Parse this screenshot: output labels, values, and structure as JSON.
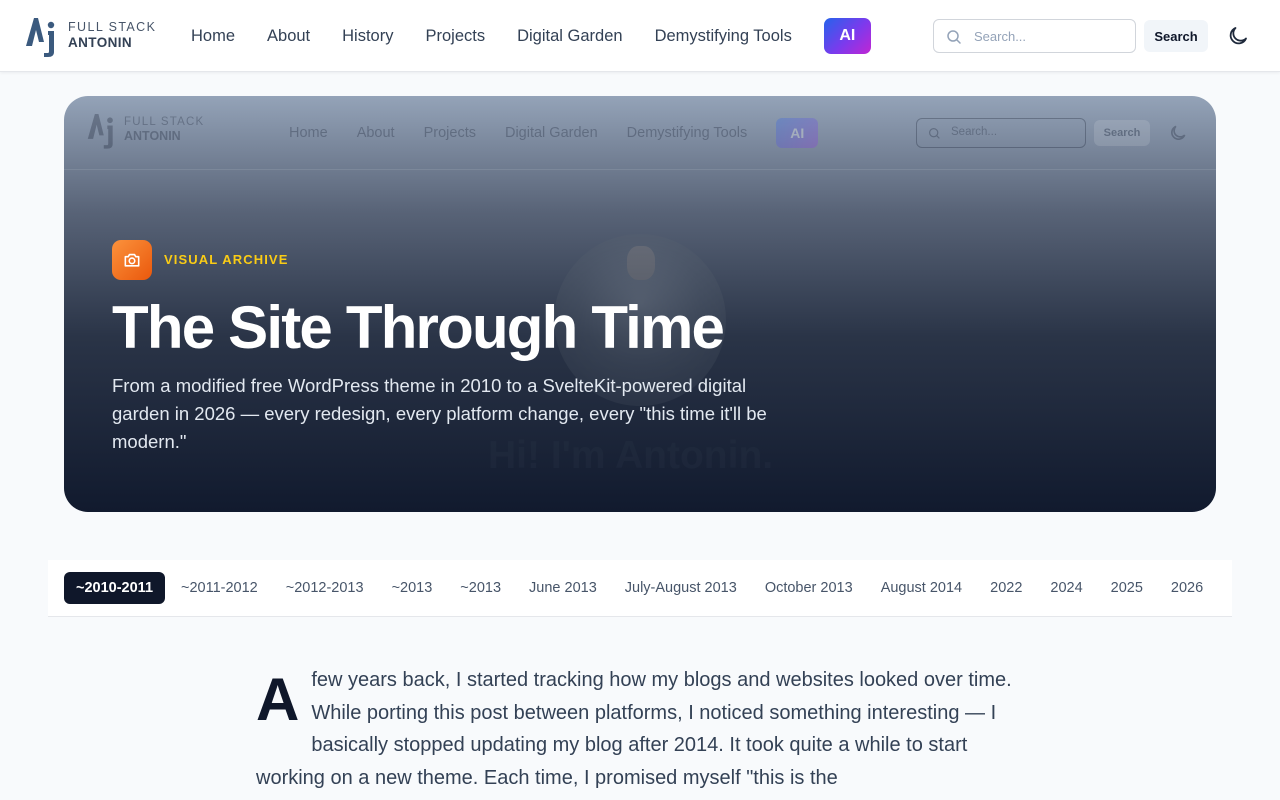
{
  "header": {
    "logo": {
      "line1": "FULL STACK",
      "line2": "ANTONIN"
    },
    "nav": [
      {
        "label": "Home"
      },
      {
        "label": "About"
      },
      {
        "label": "History"
      },
      {
        "label": "Projects"
      },
      {
        "label": "Digital Garden"
      },
      {
        "label": "Demystifying Tools"
      }
    ],
    "ai_label": "AI",
    "search": {
      "placeholder": "Search...",
      "button_label": "Search"
    }
  },
  "hero": {
    "eyebrow": "VISUAL ARCHIVE",
    "title": "The Site Through Time",
    "description": "From a modified free WordPress theme in 2010 to a SvelteKit-powered digital garden in 2026 — every redesign, every platform change, every \"this time it'll be modern.\"",
    "background_screenshot": {
      "logo": {
        "line1": "FULL STACK",
        "line2": "ANTONIN"
      },
      "nav": [
        "Home",
        "About",
        "Projects",
        "Digital Garden",
        "Demystifying Tools"
      ],
      "ai_label": "AI",
      "search_placeholder": "Search...",
      "search_button": "Search",
      "greeting": "Hi! I'm Antonin."
    }
  },
  "timeline": {
    "active_index": 0,
    "tabs": [
      "~2010-2011",
      "~2011-2012",
      "~2012-2013",
      "~2013",
      "~2013",
      "June 2013",
      "July-August 2013",
      "October 2013",
      "August 2014",
      "2022",
      "2024",
      "2025",
      "2026"
    ]
  },
  "article": {
    "dropcap": "A",
    "text": " few years back, I started tracking how my blogs and websites looked over time. While porting this post between platforms, I noticed something interesting — I basically stopped updating my blog after 2014. It took quite a while to start working on a new theme. Each time, I promised myself \"this is the"
  },
  "colors": {
    "accent_dark": "#0f172a",
    "eyebrow": "#facc15",
    "badge": "#f97316",
    "ai_gradient": [
      "#2563eb",
      "#7c3aed",
      "#c026d3"
    ]
  }
}
